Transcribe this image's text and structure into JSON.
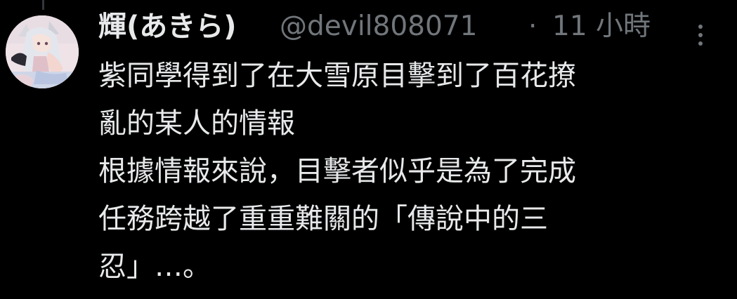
{
  "tweet": {
    "display_name": "輝(あきら)",
    "handle": "@devil808071",
    "separator": "·",
    "timestamp": "11 小時",
    "lines": [
      "紫同學得到了在大雪原目擊到了百花撩",
      "亂的某人的情報",
      "根據情報來說，目擊者似乎是為了完成",
      "任務跨越了重重難關的「傳說中的三",
      "忍」…。"
    ]
  },
  "icons": {
    "more": "more-vertical-icon"
  },
  "colors": {
    "background": "#000000",
    "primary_text": "#e7e9ea",
    "secondary_text": "#71767b"
  }
}
